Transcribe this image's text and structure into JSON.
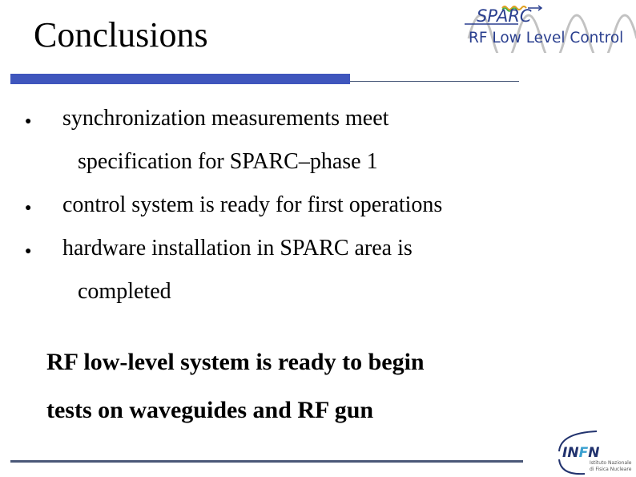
{
  "slide": {
    "title": "Conclusions",
    "bullets": [
      {
        "lines": [
          "synchronization measurements meet",
          "specification for SPARC–phase 1"
        ]
      },
      {
        "lines": [
          "control system is ready for first operations"
        ]
      },
      {
        "lines": [
          "hardware installation in SPARC area is",
          "completed"
        ]
      }
    ],
    "bullet_glyph": "●",
    "conclusion_lines": [
      "RF low-level system is ready to begin",
      "tests on waveguides and RF gun"
    ]
  },
  "logos": {
    "sparc": {
      "name": "SPARC",
      "subtitle": "RF Low Level Control"
    },
    "infn": {
      "name": "INFN",
      "line1": "Istituto Nazionale",
      "line2": "di Fisica Nucleare"
    }
  },
  "colors": {
    "accent_bar": "#3f56bd",
    "rule": "#4a5878",
    "logo_blue": "#2a3f8f",
    "wave_gray": "#b0b0b0"
  }
}
